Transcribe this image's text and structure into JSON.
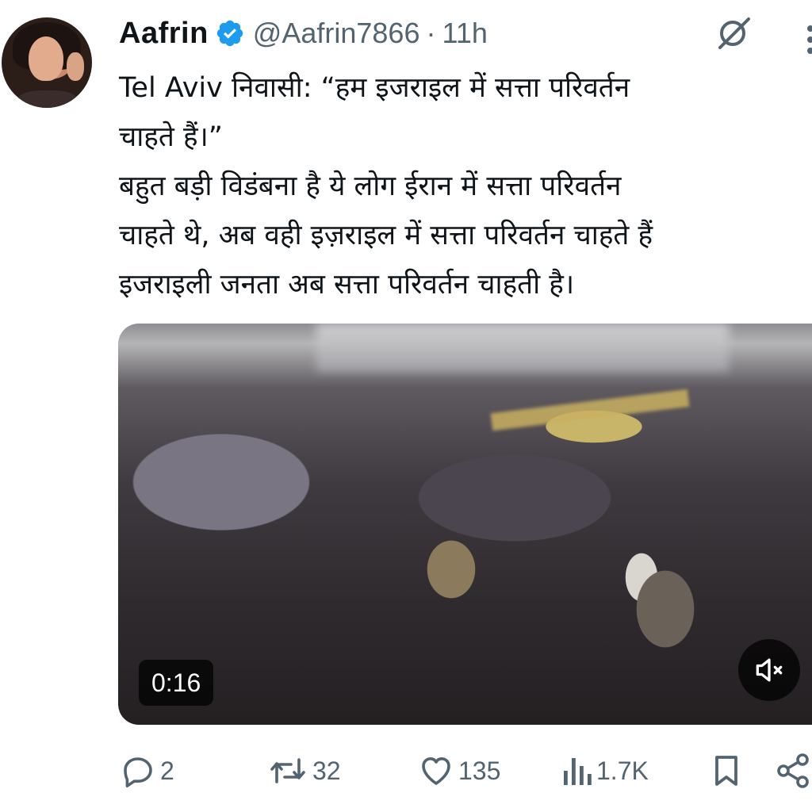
{
  "tweet": {
    "author_name": "Aafrin",
    "handle": "@Aafrin7866",
    "separator": "·",
    "time": "11h",
    "text_lines": [
      "Tel Aviv निवासी: “हम इजराइल में सत्ता परिवर्तन",
      "चाहते हैं।”",
      "बहुत बड़ी विडंबना है ये लोग ईरान में सत्ता परिवर्तन",
      "चाहते थे, अब वही इज़राइल में सत्ता परिवर्तन चाहते हैं",
      "इजराइली जनता अब सत्ता परिवर्तन चाहती है।"
    ]
  },
  "media": {
    "duration": "0:16"
  },
  "actions": {
    "replies": "2",
    "reposts": "32",
    "likes": "135",
    "views": "1.7K"
  },
  "colors": {
    "verified_badge": "#1d9bf0",
    "secondary_text": "#536471",
    "primary_text": "#0f1419"
  },
  "icons": [
    "verified-icon",
    "grok-icon",
    "more-icon",
    "mute-icon",
    "reply-icon",
    "repost-icon",
    "like-icon",
    "views-icon",
    "bookmark-icon",
    "share-icon"
  ]
}
